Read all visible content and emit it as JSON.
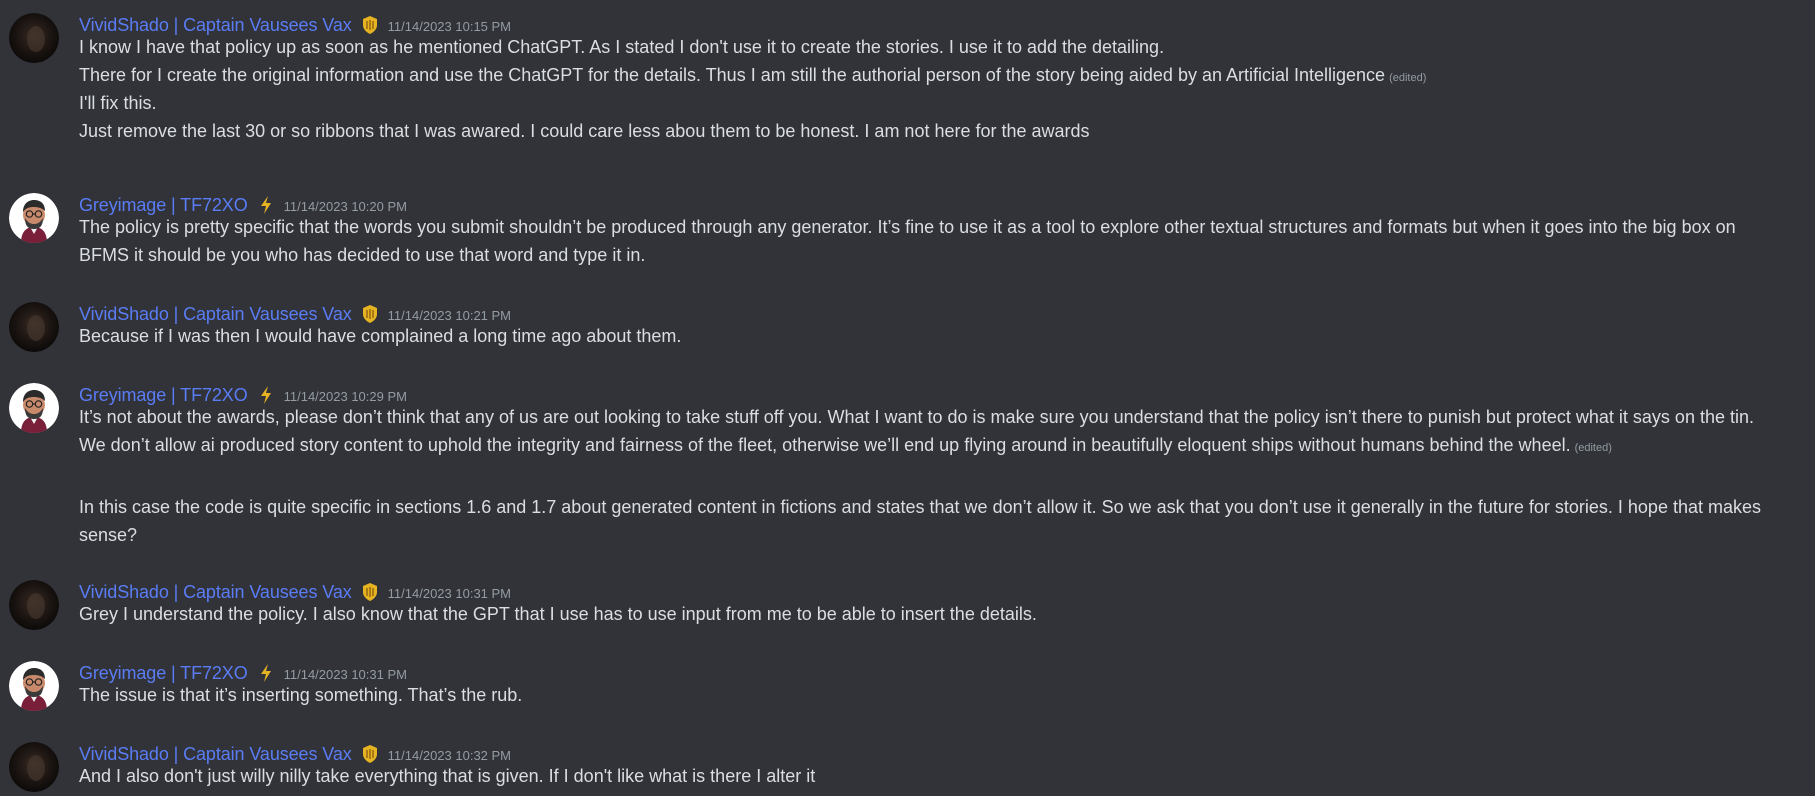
{
  "users": {
    "vivid": {
      "name": "VividShado | Captain Vausees Vax",
      "badge": "shield-lyre-icon"
    },
    "grey": {
      "name": "Greyimage | TF72XO",
      "badge": "lightning-icon"
    }
  },
  "colors": {
    "background": "#313338",
    "username": "#5a7cf5",
    "text": "#dbdee1",
    "muted": "#949ba4",
    "badge_gold": "#e6b422"
  },
  "messages": [
    {
      "author": "VividShado | Captain Vausees Vax",
      "timestamp": "11/14/2023 10:15 PM",
      "lines": [
        {
          "text": "I know I have that policy up as soon as he mentioned ChatGPT. As I stated I don't use it to create the stories. I use it to add the detailing.",
          "edited": ""
        },
        {
          "text": "There for I create the original information and use the ChatGPT for the details. Thus I am still the authorial person of the story being aided by an Artificial Intelligence",
          "edited": "(edited)"
        },
        {
          "text": "I'll fix this.",
          "edited": ""
        },
        {
          "text": "Just remove the last 30 or so ribbons that I was awared. I could care less abou them to be honest. I am not here for the awards",
          "edited": ""
        }
      ]
    },
    {
      "author": "Greyimage | TF72XO",
      "timestamp": "11/14/2023 10:20 PM",
      "lines": [
        {
          "text": "The policy is pretty specific that the words you submit shouldn’t be produced through any generator. It’s fine to use it as a tool to explore other textual structures and formats but when it goes into the big box on BFMS it should be you who has decided to use that word and type it in.",
          "edited": ""
        }
      ]
    },
    {
      "author": "VividShado | Captain Vausees Vax",
      "timestamp": "11/14/2023 10:21 PM",
      "lines": [
        {
          "text": "Because if I was then I would have complained a long time ago about them.",
          "edited": ""
        }
      ]
    },
    {
      "author": "Greyimage | TF72XO",
      "timestamp": "11/14/2023 10:29 PM",
      "lines": [
        {
          "text": "It’s not about the awards, please don’t think that any of us are out looking to take stuff off you. What I want to do is make sure you understand that the policy isn’t there to punish but protect what it says on the tin. We don’t allow ai produced story content to uphold the integrity and fairness of the fleet, otherwise we’ll end up flying around in beautifully eloquent ships without humans behind the wheel.",
          "edited": "(edited)"
        },
        {
          "text": "In this case the code is quite specific in sections 1.6 and 1.7 about generated content in fictions and states that we don’t allow it. So we ask that you don’t use it generally in the future for stories. I hope that makes sense?",
          "edited": ""
        }
      ]
    },
    {
      "author": "VividShado | Captain Vausees Vax",
      "timestamp": "11/14/2023 10:31 PM",
      "lines": [
        {
          "text": "Grey I understand the policy. I also know that the GPT that I use has to use input from me to be able to insert the details.",
          "edited": ""
        }
      ]
    },
    {
      "author": "Greyimage | TF72XO",
      "timestamp": "11/14/2023 10:31 PM",
      "lines": [
        {
          "text": "The issue is that it’s inserting something. That’s the rub.",
          "edited": ""
        }
      ]
    },
    {
      "author": "VividShado | Captain Vausees Vax",
      "timestamp": "11/14/2023 10:32 PM",
      "lines": [
        {
          "text": "And I also don't just willy nilly take everything that is given. If I don't like what is there I alter it",
          "edited": ""
        }
      ]
    }
  ]
}
